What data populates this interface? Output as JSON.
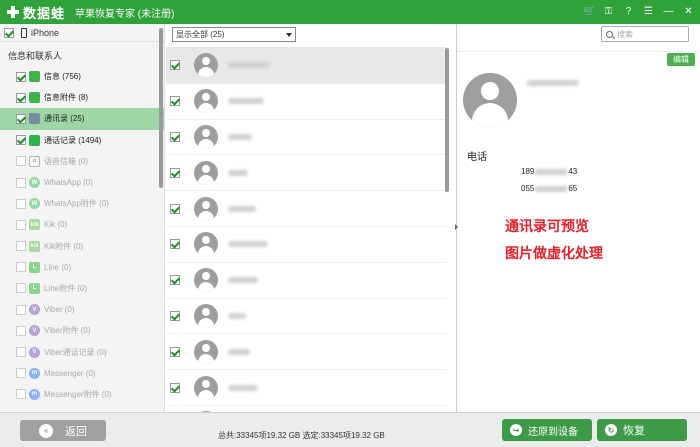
{
  "titlebar": {
    "app_name": "数据蛙",
    "subtitle": "苹果恢复专家 (未注册)",
    "icons": [
      "cart-icon",
      "key-icon",
      "help-icon",
      "menu-icon",
      "minimize-icon",
      "close-icon"
    ]
  },
  "sidebar": {
    "device": "iPhone",
    "section": "信息和联系人",
    "items": [
      {
        "label": "信息 (756)",
        "icon": "msg",
        "checked": true,
        "enabled": true
      },
      {
        "label": "信息附件 (8)",
        "icon": "msg",
        "checked": true,
        "enabled": true
      },
      {
        "label": "通讯录 (25)",
        "icon": "contacts",
        "checked": true,
        "enabled": true,
        "selected": true
      },
      {
        "label": "通话记录 (1494)",
        "icon": "calls",
        "checked": true,
        "enabled": true
      },
      {
        "label": "语音信箱 (0)",
        "icon": "voice",
        "checked": false,
        "enabled": false
      },
      {
        "label": "WhatsApp (0)",
        "icon": "whatsapp",
        "checked": false,
        "enabled": false
      },
      {
        "label": "WhatsApp附件 (0)",
        "icon": "whatsapp",
        "checked": false,
        "enabled": false
      },
      {
        "label": "Kik (0)",
        "icon": "kik",
        "checked": false,
        "enabled": false
      },
      {
        "label": "Kik附件 (0)",
        "icon": "kik",
        "checked": false,
        "enabled": false
      },
      {
        "label": "Line (0)",
        "icon": "line",
        "checked": false,
        "enabled": false
      },
      {
        "label": "Line附件 (0)",
        "icon": "line",
        "checked": false,
        "enabled": false
      },
      {
        "label": "Viber (0)",
        "icon": "viber",
        "checked": false,
        "enabled": false
      },
      {
        "label": "Viber附件 (0)",
        "icon": "viber",
        "checked": false,
        "enabled": false
      },
      {
        "label": "Viber通话记录 (0)",
        "icon": "viber",
        "checked": false,
        "enabled": false
      },
      {
        "label": "Messenger (0)",
        "icon": "messenger",
        "checked": false,
        "enabled": false
      },
      {
        "label": "Messenger附件 (0)",
        "icon": "messenger",
        "checked": false,
        "enabled": false
      }
    ]
  },
  "list": {
    "filter_value": "显示全部 (25)",
    "rows": [
      {
        "selected": true
      },
      {
        "selected": false
      },
      {
        "selected": false
      },
      {
        "selected": false
      },
      {
        "selected": false
      },
      {
        "selected": false
      },
      {
        "selected": false
      },
      {
        "selected": false
      },
      {
        "selected": false
      },
      {
        "selected": false
      },
      {
        "selected": false
      }
    ]
  },
  "search": {
    "placeholder": "搜索"
  },
  "detail": {
    "edit_label": "编辑",
    "phone_label": "电话",
    "phones": [
      {
        "prefix": "189",
        "suffix": "43"
      },
      {
        "prefix": "055",
        "suffix": "65"
      }
    ],
    "note_lines": [
      "通讯录可预览",
      "图片做虚化处理"
    ]
  },
  "bottombar": {
    "back_label": "返回",
    "status": "总共:33345项19.32 GB 选定:33345项19.32 GB",
    "restore_device_label": "还原到设备",
    "restore_label": "恢复"
  }
}
